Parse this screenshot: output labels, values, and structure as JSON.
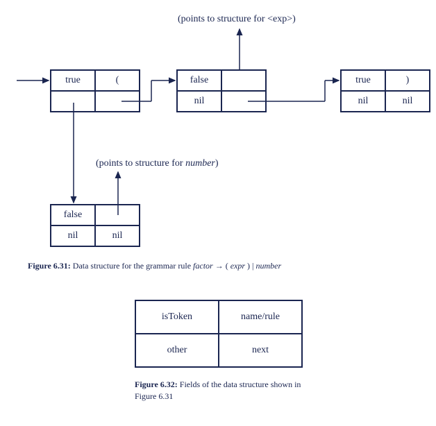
{
  "annotations": {
    "top": "(points to structure for <exp>)",
    "mid": "(points to structure for number)",
    "mid_plain": "(points to structure for ",
    "mid_italic": "number",
    "mid_close": ")"
  },
  "nodeA": {
    "r0c0": "true",
    "r0c1": "(",
    "r1c0": "",
    "r1c1": ""
  },
  "nodeB": {
    "r0c0": "false",
    "r0c1": "",
    "r1c0": "nil",
    "r1c1": ""
  },
  "nodeC": {
    "r0c0": "true",
    "r0c1": ")",
    "r1c0": "nil",
    "r1c1": "nil"
  },
  "nodeD": {
    "r0c0": "false",
    "r0c1": "",
    "r1c0": "nil",
    "r1c1": "nil"
  },
  "fig631": {
    "label": "Figure 6.31:",
    "text_before": " Data structure for the grammar rule ",
    "rule_lhs": "factor",
    "arrow": " → ",
    "rule_rhs_open": "  ( ",
    "rule_rhs_expr": "expr",
    "rule_rhs_mid": " )  | ",
    "rule_rhs_num": "number"
  },
  "fields": {
    "r0c0": "isToken",
    "r0c1": "name/rule",
    "r1c0": "other",
    "r1c1": "next"
  },
  "fig632": {
    "label": "Figure 6.32:",
    "text": " Fields of the data structure shown in Figure 6.31"
  }
}
